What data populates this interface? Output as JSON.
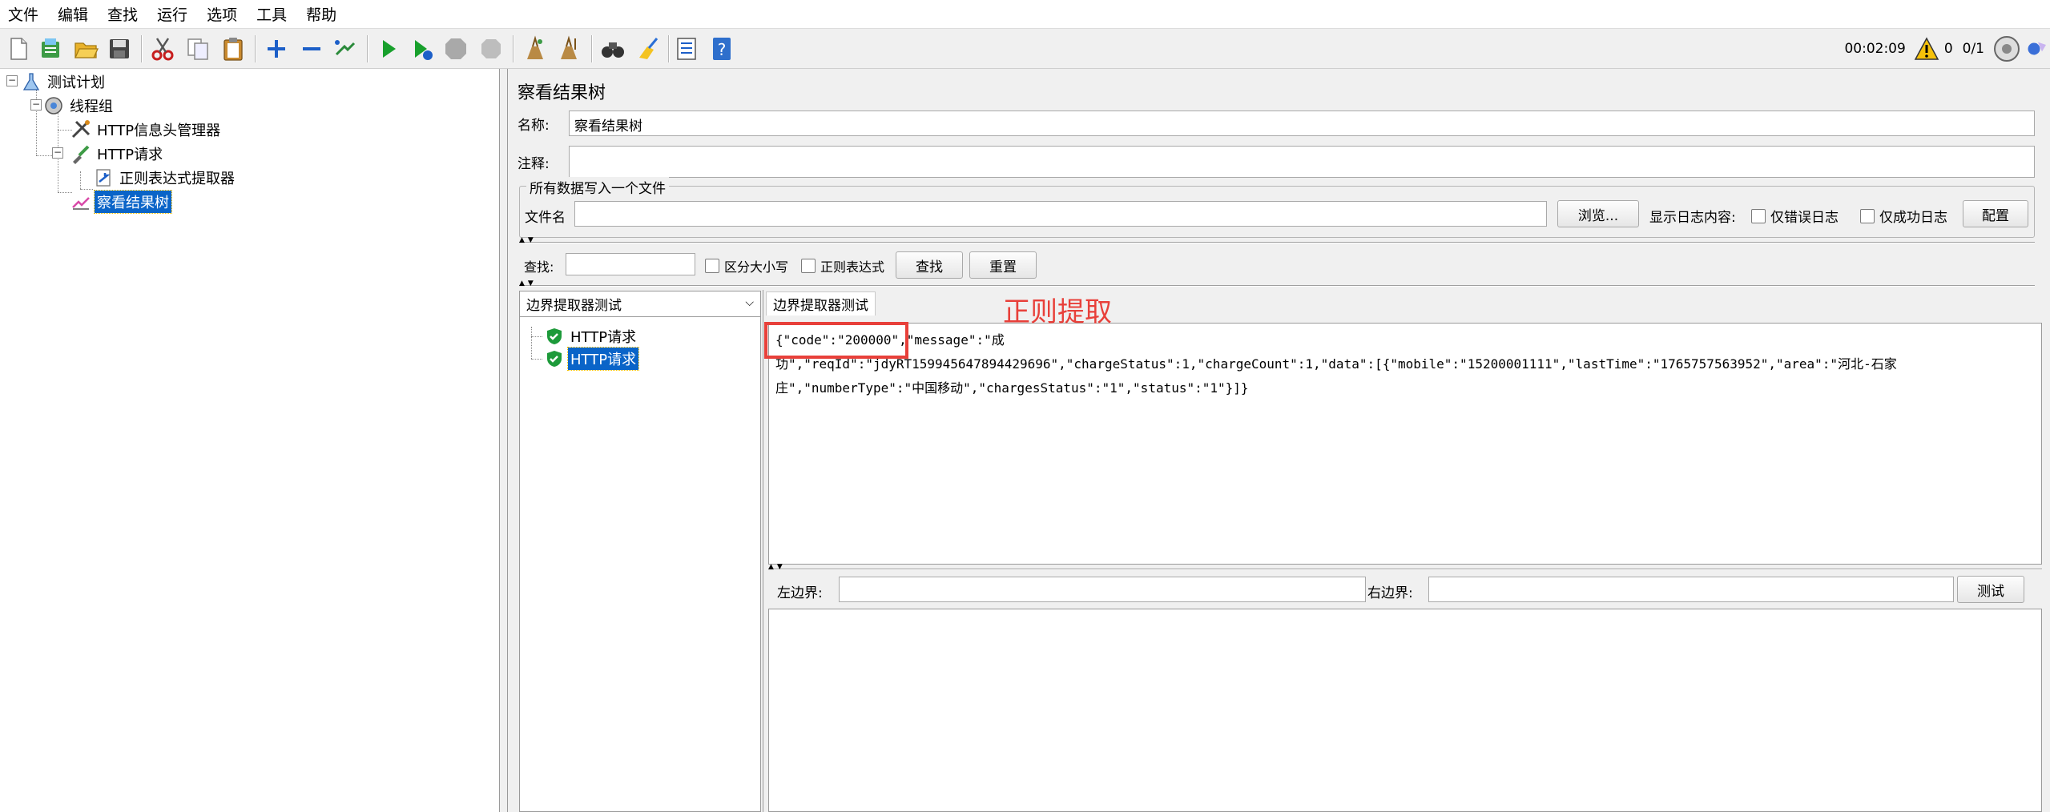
{
  "menubar": {
    "items": [
      "文件",
      "编辑",
      "查找",
      "运行",
      "选项",
      "工具",
      "帮助"
    ]
  },
  "toolbar": {
    "icons": [
      "new-icon",
      "templates-icon",
      "open-icon",
      "save-icon",
      "cut-icon",
      "copy-icon",
      "paste-icon",
      "expand-icon",
      "collapse-icon",
      "toggle-icon",
      "start-icon",
      "start-no-pause-icon",
      "stop-icon",
      "shutdown-icon",
      "clear-icon",
      "clear-all-icon",
      "search-icon",
      "reset-search-icon",
      "function-helper-icon",
      "help-icon"
    ],
    "elapsed_time": "00:02:09",
    "warning_count": "0",
    "thread_ratio": "0/1"
  },
  "tree": {
    "nodes": [
      {
        "label": "测试计划",
        "icon": "test-plan-icon"
      },
      {
        "label": "线程组",
        "icon": "thread-group-icon"
      },
      {
        "label": "HTTP信息头管理器",
        "icon": "header-manager-icon"
      },
      {
        "label": "HTTP请求",
        "icon": "http-sampler-icon"
      },
      {
        "label": "正则表达式提取器",
        "icon": "regex-extractor-icon"
      },
      {
        "label": "察看结果树",
        "icon": "result-tree-icon"
      }
    ]
  },
  "panel": {
    "title": "察看结果树",
    "name_label": "名称:",
    "name_value": "察看结果树",
    "comment_label": "注释:",
    "comment_value": "",
    "file_group_title": "所有数据写入一个文件",
    "filename_label": "文件名",
    "filename_value": "",
    "browse_button": "浏览...",
    "log_display_label": "显示日志内容:",
    "errors_only_label": "仅错误日志",
    "success_only_label": "仅成功日志",
    "configure_button": "配置"
  },
  "search": {
    "label": "查找:",
    "value": "",
    "case_sensitive_label": "区分大小写",
    "regex_label": "正则表达式",
    "find_button": "查找",
    "reset_button": "重置"
  },
  "results": {
    "renderer": "边界提取器测试",
    "samples": [
      "HTTP请求",
      "HTTP请求"
    ],
    "status_icon": "success-shield-icon"
  },
  "extractor": {
    "tab_label": "边界提取器测试",
    "response_text": "{\"code\":\"200000\",\"message\":\"成功\",\"reqId\":\"jdyRT15994564789442969​6\",\"chargeStatus\":1,\"chargeCount\":1,\"data\":[{\"mobile\":\"15200001111\",\"lastTime\":\"1765757563952\",\"area\":\"河北-石家庄\",\"numberType\":\"中国移动\",\"chargesStatus\":\"1\",\"status\":\"1\"}]}",
    "line1": "{\"code\":\"200000\",\"message\":\"成",
    "line2": "功\",\"reqId\":\"jdyRT1599456478944296​96\",\"chargeStatus\":1,\"chargeCount\":1,\"data\":[{\"mobile\":\"15200001111\",\"lastTime\":\"1765757563952\",\"area\":\"河北-石家",
    "line3": "庄\",\"numberType\":\"中国移动\",\"chargesStatus\":\"1\",\"status\":\"1\"}]}",
    "annotation": "正则提取",
    "left_boundary_label": "左边界:",
    "left_boundary_value": "",
    "right_boundary_label": "右边界:",
    "right_boundary_value": "",
    "test_button": "测试"
  },
  "colors": {
    "selection": "#0a64c8",
    "annotation": "#e8403a",
    "panel_bg": "#f0f0f0"
  }
}
